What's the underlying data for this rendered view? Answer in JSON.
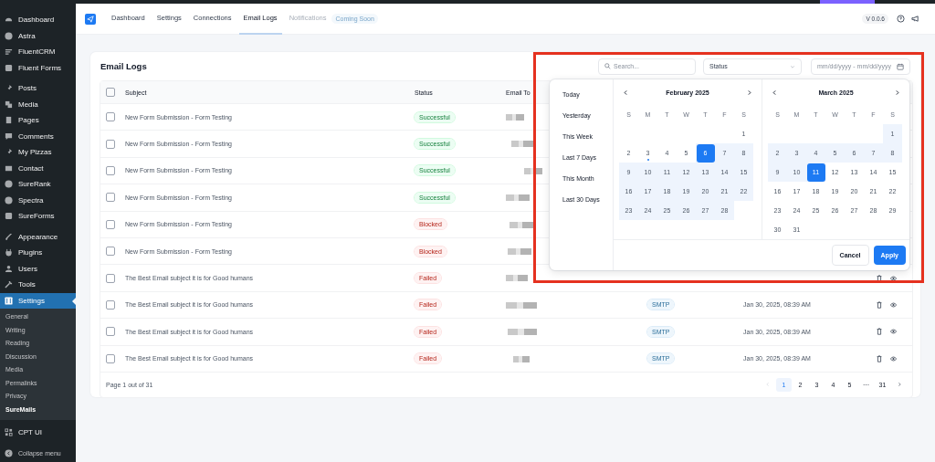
{
  "sidebar": {
    "groups": [
      {
        "items": [
          {
            "label": "Dashboard",
            "selected": false
          },
          {
            "label": "Astra",
            "selected": false
          },
          {
            "label": "FluentCRM",
            "selected": false
          },
          {
            "label": "Fluent Forms",
            "selected": false
          }
        ]
      },
      {
        "items": [
          {
            "label": "Posts",
            "selected": false
          },
          {
            "label": "Media",
            "selected": false
          },
          {
            "label": "Pages",
            "selected": false
          },
          {
            "label": "Comments",
            "selected": false
          },
          {
            "label": "My Pizzas",
            "selected": false
          },
          {
            "label": "Contact",
            "selected": false
          },
          {
            "label": "SureRank",
            "selected": false
          },
          {
            "label": "Spectra",
            "selected": false
          },
          {
            "label": "SureForms",
            "selected": false
          }
        ]
      },
      {
        "items": [
          {
            "label": "Appearance",
            "selected": false
          },
          {
            "label": "Plugins",
            "selected": false
          },
          {
            "label": "Users",
            "selected": false
          },
          {
            "label": "Tools",
            "selected": false
          },
          {
            "label": "Settings",
            "selected": true,
            "submenu": [
              {
                "label": "General",
                "selected": false
              },
              {
                "label": "Writing",
                "selected": false
              },
              {
                "label": "Reading",
                "selected": false
              },
              {
                "label": "Discussion",
                "selected": false
              },
              {
                "label": "Media",
                "selected": false
              },
              {
                "label": "Permalinks",
                "selected": false
              },
              {
                "label": "Privacy",
                "selected": false
              },
              {
                "label": "SureMails",
                "selected": true
              }
            ]
          }
        ]
      },
      {
        "items": [
          {
            "label": "CPT UI",
            "selected": false
          }
        ]
      }
    ],
    "collapse": {
      "label": "Collapse menu"
    }
  },
  "nav": {
    "tabs": [
      {
        "label": "Dashboard",
        "selected": false,
        "disabled": false
      },
      {
        "label": "Settings",
        "selected": false,
        "disabled": false
      },
      {
        "label": "Connections",
        "selected": false,
        "disabled": false
      },
      {
        "label": "Email Logs",
        "selected": true,
        "disabled": false
      },
      {
        "label": "Notifications",
        "selected": false,
        "disabled": true,
        "badge": "Coming Soon"
      }
    ],
    "version": "V 0.0.6"
  },
  "card": {
    "title": "Email Logs",
    "search": {
      "placeholder": "Search..."
    },
    "status_filter": {
      "value": "Status"
    },
    "date_filter": {
      "placeholder": "mm/dd/yyyy - mm/dd/yyyy"
    }
  },
  "table": {
    "select_all_checked": false,
    "columns": [
      "Subject",
      "Status",
      "Email To"
    ],
    "rows": [
      {
        "subject": "New Form Submission - Form Testing",
        "status": {
          "label": "Successful",
          "kind": "success"
        },
        "checked": false
      },
      {
        "subject": "New Form Submission - Form Testing",
        "status": {
          "label": "Successful",
          "kind": "success"
        },
        "checked": false
      },
      {
        "subject": "New Form Submission - Form Testing",
        "status": {
          "label": "Successful",
          "kind": "success"
        },
        "checked": false
      },
      {
        "subject": "New Form Submission - Form Testing",
        "status": {
          "label": "Successful",
          "kind": "success"
        },
        "checked": false
      },
      {
        "subject": "New Form Submission - Form Testing",
        "status": {
          "label": "Blocked",
          "kind": "error"
        },
        "checked": false
      },
      {
        "subject": "New Form Submission - Form Testing",
        "status": {
          "label": "Blocked",
          "kind": "error"
        },
        "checked": false
      },
      {
        "subject": "The Best Email subject it is for Good humans",
        "status": {
          "label": "Failed",
          "kind": "error"
        },
        "checked": false
      },
      {
        "subject": "The Best Email subject it is for Good humans",
        "status": {
          "label": "Failed",
          "kind": "error"
        },
        "checked": false,
        "connection": "SMTP",
        "date": "Jan 30, 2025, 08:39 AM"
      },
      {
        "subject": "The Best Email subject it is for Good humans",
        "status": {
          "label": "Failed",
          "kind": "error"
        },
        "checked": false,
        "connection": "SMTP",
        "date": "Jan 30, 2025, 08:39 AM"
      },
      {
        "subject": "The Best Email subject it is for Good humans",
        "status": {
          "label": "Failed",
          "kind": "error"
        },
        "checked": false,
        "connection": "SMTP",
        "date": "Jan 30, 2025, 08:39 AM"
      }
    ]
  },
  "pagination": {
    "summary": "Page 1 out of 31",
    "pages": [
      {
        "label": "1",
        "selected": true
      },
      {
        "label": "2",
        "selected": false
      },
      {
        "label": "3",
        "selected": false
      },
      {
        "label": "4",
        "selected": false
      },
      {
        "label": "5",
        "selected": false
      },
      {
        "label": "···",
        "selected": false
      },
      {
        "label": "31",
        "selected": false
      }
    ]
  },
  "date_picker": {
    "presets": [
      "Today",
      "Yesterday",
      "This Week",
      "Last 7 Days",
      "This Month",
      "Last 30 Days"
    ],
    "months": [
      {
        "title": "February 2025",
        "weekdays": [
          "S",
          "M",
          "T",
          "W",
          "T",
          "F",
          "S"
        ],
        "weeks": [
          [
            {
              "day": "1",
              "selected": false,
              "in_range": false,
              "today": false
            }
          ],
          [
            {
              "day": "2",
              "selected": false,
              "in_range": false,
              "today": false
            },
            {
              "day": "3",
              "selected": false,
              "in_range": false,
              "today": true
            },
            {
              "day": "4",
              "selected": false,
              "in_range": false,
              "today": false
            },
            {
              "day": "5",
              "selected": false,
              "in_range": false,
              "today": false
            },
            {
              "day": "6",
              "selected": true,
              "in_range": true,
              "today": false
            },
            {
              "day": "7",
              "selected": false,
              "in_range": true,
              "today": false
            },
            {
              "day": "8",
              "selected": false,
              "in_range": true,
              "today": false
            }
          ],
          [
            {
              "day": "9",
              "selected": false,
              "in_range": true,
              "today": false
            },
            {
              "day": "10",
              "selected": false,
              "in_range": true,
              "today": false
            },
            {
              "day": "11",
              "selected": false,
              "in_range": true,
              "today": false
            },
            {
              "day": "12",
              "selected": false,
              "in_range": true,
              "today": false
            },
            {
              "day": "13",
              "selected": false,
              "in_range": true,
              "today": false
            },
            {
              "day": "14",
              "selected": false,
              "in_range": true,
              "today": false
            },
            {
              "day": "15",
              "selected": false,
              "in_range": true,
              "today": false
            }
          ],
          [
            {
              "day": "16",
              "selected": false,
              "in_range": true,
              "today": false
            },
            {
              "day": "17",
              "selected": false,
              "in_range": true,
              "today": false
            },
            {
              "day": "18",
              "selected": false,
              "in_range": true,
              "today": false
            },
            {
              "day": "19",
              "selected": false,
              "in_range": true,
              "today": false
            },
            {
              "day": "20",
              "selected": false,
              "in_range": true,
              "today": false
            },
            {
              "day": "21",
              "selected": false,
              "in_range": true,
              "today": false
            },
            {
              "day": "22",
              "selected": false,
              "in_range": true,
              "today": false
            }
          ],
          [
            {
              "day": "23",
              "selected": false,
              "in_range": true,
              "today": false
            },
            {
              "day": "24",
              "selected": false,
              "in_range": true,
              "today": false
            },
            {
              "day": "25",
              "selected": false,
              "in_range": true,
              "today": false
            },
            {
              "day": "26",
              "selected": false,
              "in_range": true,
              "today": false
            },
            {
              "day": "27",
              "selected": false,
              "in_range": true,
              "today": false
            },
            {
              "day": "28",
              "selected": false,
              "in_range": true,
              "today": false
            }
          ]
        ]
      },
      {
        "title": "March 2025",
        "weekdays": [
          "S",
          "M",
          "T",
          "W",
          "T",
          "F",
          "S"
        ],
        "weeks": [
          [
            {
              "day": "1",
              "selected": false,
              "in_range": true,
              "today": false
            }
          ],
          [
            {
              "day": "2",
              "selected": false,
              "in_range": true,
              "today": false
            },
            {
              "day": "3",
              "selected": false,
              "in_range": true,
              "today": false
            },
            {
              "day": "4",
              "selected": false,
              "in_range": true,
              "today": false
            },
            {
              "day": "5",
              "selected": false,
              "in_range": true,
              "today": false
            },
            {
              "day": "6",
              "selected": false,
              "in_range": true,
              "today": false
            },
            {
              "day": "7",
              "selected": false,
              "in_range": true,
              "today": false
            },
            {
              "day": "8",
              "selected": false,
              "in_range": true,
              "today": false
            }
          ],
          [
            {
              "day": "9",
              "selected": false,
              "in_range": true,
              "today": false
            },
            {
              "day": "10",
              "selected": false,
              "in_range": true,
              "today": false
            },
            {
              "day": "11",
              "selected": true,
              "in_range": true,
              "today": false
            },
            {
              "day": "12",
              "selected": false,
              "in_range": false,
              "today": false
            },
            {
              "day": "13",
              "selected": false,
              "in_range": false,
              "today": false
            },
            {
              "day": "14",
              "selected": false,
              "in_range": false,
              "today": false
            },
            {
              "day": "15",
              "selected": false,
              "in_range": false,
              "today": false
            }
          ],
          [
            {
              "day": "16",
              "selected": false,
              "in_range": false,
              "today": false
            },
            {
              "day": "17",
              "selected": false,
              "in_range": false,
              "today": false
            },
            {
              "day": "18",
              "selected": false,
              "in_range": false,
              "today": false
            },
            {
              "day": "19",
              "selected": false,
              "in_range": false,
              "today": false
            },
            {
              "day": "20",
              "selected": false,
              "in_range": false,
              "today": false
            },
            {
              "day": "21",
              "selected": false,
              "in_range": false,
              "today": false
            },
            {
              "day": "22",
              "selected": false,
              "in_range": false,
              "today": false
            }
          ],
          [
            {
              "day": "23",
              "selected": false,
              "in_range": false,
              "today": false
            },
            {
              "day": "24",
              "selected": false,
              "in_range": false,
              "today": false
            },
            {
              "day": "25",
              "selected": false,
              "in_range": false,
              "today": false
            },
            {
              "day": "26",
              "selected": false,
              "in_range": false,
              "today": false
            },
            {
              "day": "27",
              "selected": false,
              "in_range": false,
              "today": false
            },
            {
              "day": "28",
              "selected": false,
              "in_range": false,
              "today": false
            },
            {
              "day": "29",
              "selected": false,
              "in_range": false,
              "today": false
            }
          ],
          [
            {
              "day": "30",
              "selected": false,
              "in_range": false,
              "today": false
            },
            {
              "day": "31",
              "selected": false,
              "in_range": false,
              "today": false
            }
          ]
        ]
      }
    ],
    "buttons": {
      "cancel": "Cancel",
      "apply": "Apply"
    }
  }
}
